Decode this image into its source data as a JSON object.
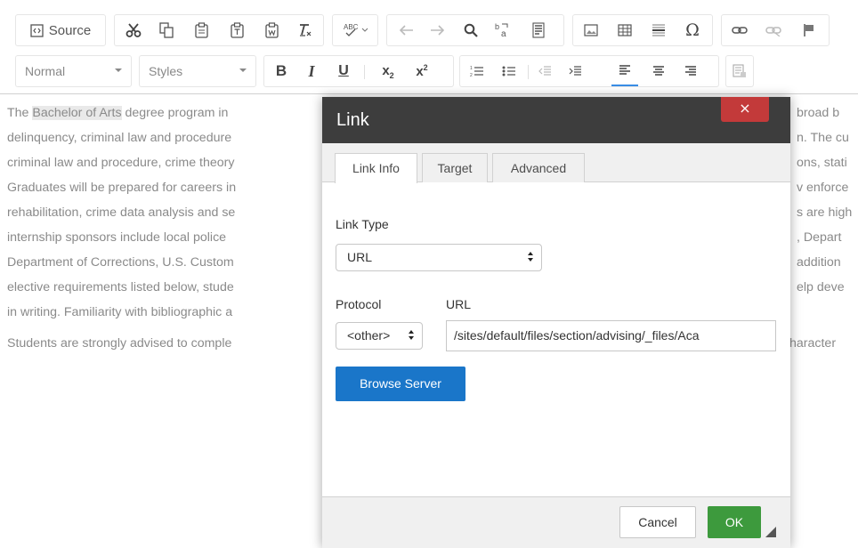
{
  "toolbar": {
    "source_label": "Source",
    "format_value": "Normal",
    "styles_value": "Styles"
  },
  "content": {
    "p1_lines": [
      {
        "pre": "The ",
        "hl": "Bachelor of Arts",
        "post": " degree program in",
        "right": "broad b"
      },
      {
        "pre": "delinquency, criminal law and procedure",
        "hl": "",
        "post": "",
        "right": "n. The cu"
      },
      {
        "pre": "criminal law and procedure, crime theory",
        "hl": "",
        "post": "",
        "right": "ons, stati"
      },
      {
        "pre": "Graduates will be prepared for careers in",
        "hl": "",
        "post": "",
        "right": "v enforce"
      },
      {
        "pre": "rehabilitation, crime data analysis and se",
        "hl": "",
        "post": "",
        "right": "s are high"
      },
      {
        "pre": "internship sponsors include local police",
        "hl": "",
        "post": "",
        "right": ", Depart"
      },
      {
        "pre": "Department of Corrections, U.S. Custom",
        "hl": "",
        "post": "",
        "right": "addition"
      },
      {
        "pre": "elective requirements listed below, stude",
        "hl": "",
        "post": "",
        "right": "elp deve"
      },
      {
        "pre": "in writing. Familiarity with bibliographic a",
        "hl": "",
        "post": "",
        "right": ""
      }
    ],
    "p2_line": {
      "left": "Students are strongly advised to comple",
      "right": "haracter"
    }
  },
  "dialog": {
    "title": "Link",
    "close_glyph": "×",
    "tabs": [
      "Link Info",
      "Target",
      "Advanced"
    ],
    "link_type_label": "Link Type",
    "link_type_value": "URL",
    "protocol_label": "Protocol",
    "protocol_value": "<other>",
    "url_label": "URL",
    "url_value": "/sites/default/files/section/advising/_files/Aca",
    "browse_label": "Browse Server",
    "cancel_label": "Cancel",
    "ok_label": "OK"
  }
}
